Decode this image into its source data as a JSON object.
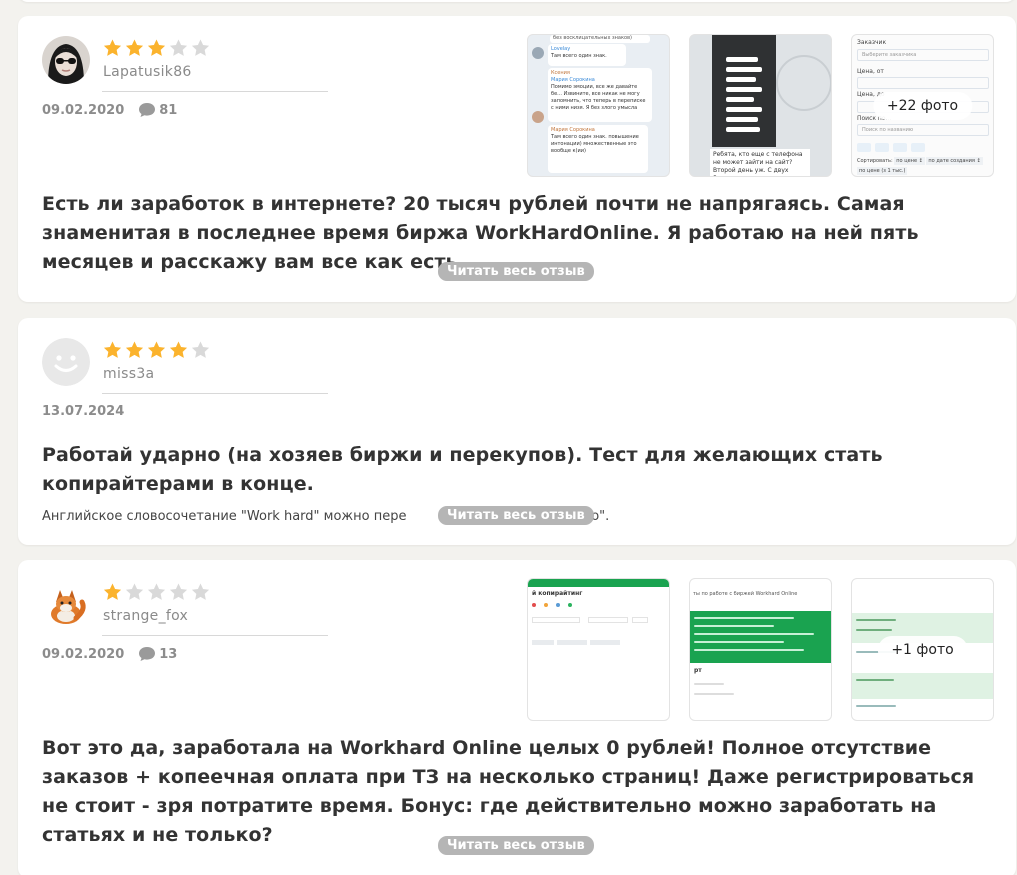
{
  "colors": {
    "star_filled": "#fbb32d",
    "star_empty": "#d9d9d9",
    "read_more_bg": "#b5b5b5"
  },
  "reviews": [
    {
      "username": "Lapatusik86",
      "rating": 3,
      "date": "09.02.2020",
      "comments": "81",
      "more_photos": "+22 фото",
      "title": "Есть ли заработок в интернете? 20 тысяч рублей почти не напрягаясь. Самая знаменитая в последнее время биржа WorkHardOnline. Я работаю на ней пять месяцев и расскажу вам все как есть.",
      "read_more": "Читать весь отзыв",
      "thumb_texts": {
        "chat_line1": "без восклицательных знаков)",
        "chat_name1": "Lovelay",
        "chat_line2": "Там всего один знак.",
        "chat_name2": "Ксения",
        "chat_name3": "Мария Сорокина",
        "chat_line3": "Помимо эмоции, все же давайте бе... Извините, все никак не могу запомнить, что теперь в переписке с ними низя. Я без злого умысла",
        "chat_name4": "Мария Сорокина",
        "chat_line4": "Там всего один знак. повышение интонации) множественные это вообще к(ии)",
        "phone_caption": "Ребята, кто еще с телефона не может зайти на сайт? Второй день уж. С двух браузеров",
        "form_label1": "Заказчик",
        "form_placeholder1": "Выберите заказчика",
        "form_label2": "Цена, от",
        "form_label3": "Цена, до",
        "form_label4": "Поиск по...",
        "form_placeholder4": "Поиск по названию",
        "form_sort": "Сортировать:",
        "form_sort_opt1": "по цене ↕",
        "form_sort_opt2": "по дате создания ↕",
        "form_sort_opt3": "по цене (з 1 тыс.)"
      }
    },
    {
      "username": "miss3a",
      "rating": 4,
      "date": "13.07.2024",
      "title": "Работай ударно (на хозяев биржи и перекупов). Тест для желающих стать копирайтерами в конце.",
      "excerpt": "Английское словосочетание \"Work hard\" можно пере",
      "excerpt_tail": "рно\".",
      "read_more": "Читать весь отзыв"
    },
    {
      "username": "strange_fox",
      "rating": 1,
      "date": "09.02.2020",
      "comments": "13",
      "more_photos": "+1 фото",
      "title": "Вот это да, заработала на Workhard Online целых 0 рублей! Полное отсутствие заказов + копеечная оплата при ТЗ на несколько страниц! Даже регистрироваться не стоит - зря потратите время. Бонус: где действительно можно заработать на статьях и не только?",
      "read_more": "Читать весь отзыв",
      "thumb_texts": {
        "t1_title": "й копирайтинг",
        "t2_title": "ты по работе с биржей Workhard Online",
        "t2_footer": "рт"
      }
    }
  ]
}
